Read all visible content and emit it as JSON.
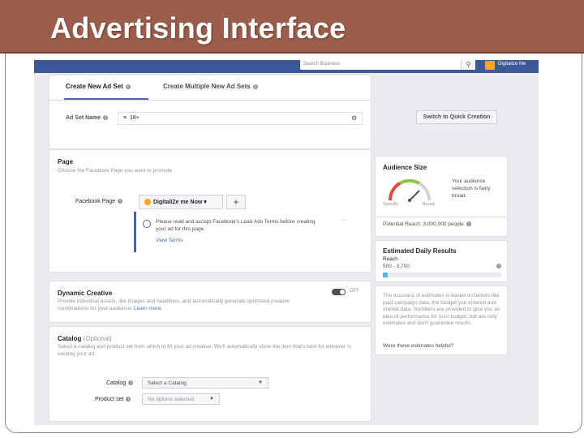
{
  "slide": {
    "title": "Advertising Interface"
  },
  "topbar": {
    "search_placeholder": "Search Business",
    "user_name": "Digitalize Me"
  },
  "tabs": {
    "create_new": "Create New Ad Set",
    "create_multiple": "Create Multiple New Ad Sets"
  },
  "adset": {
    "label": "Ad Set Name",
    "value": "18+",
    "quick_button": "Switch to Quick Creation"
  },
  "page_section": {
    "title": "Page",
    "description": "Choose the Facebook Page you want to promote.",
    "fb_page_label": "Facebook Page",
    "selected_page": "DigitalIZe me Now",
    "notice_text": "Please read and accept Facebook's Lead Ads Terms before creating your ad for this page.",
    "notice_link": "View Terms"
  },
  "dynamic": {
    "title": "Dynamic Creative",
    "description": "Provide individual assets, like images and headlines, and automatically generate optimized creative combinations for your audience.",
    "learn_more": "Learn more.",
    "toggle_label": "OFF"
  },
  "catalog": {
    "title": "Catalog",
    "optional": "(Optional)",
    "description": "Select a catalog and product set from which to fill your ad creative. We'll automatically show the item that's best for whoever is viewing your ad.",
    "catalog_label": "Catalog",
    "catalog_value": "Select a Catalog",
    "product_label": "Product set",
    "product_value": "No options selected"
  },
  "audience": {
    "title": "Audience Size",
    "description": "Your audience selection is fairly broad.",
    "specific": "Specific",
    "broad": "Broad",
    "potential_reach": "Potential Reach: 3,000,000 people"
  },
  "daily": {
    "title": "Estimated Daily Results",
    "reach_label": "Reach",
    "reach_value": "500 - 3,700"
  },
  "accuracy": {
    "text": "The accuracy of estimates is based on factors like past campaign data, the budget you entered and market data. Numbers are provided to give you an idea of performance for your budget, but are only estimates and don't guarantee results.",
    "link": "Were these estimates helpful?"
  },
  "colors": {
    "title_bar": "#9b5e4b",
    "fb_blue": "#4267b2",
    "fb_topbar": "#3b5998",
    "reach_fill": "#4bb8e5"
  }
}
